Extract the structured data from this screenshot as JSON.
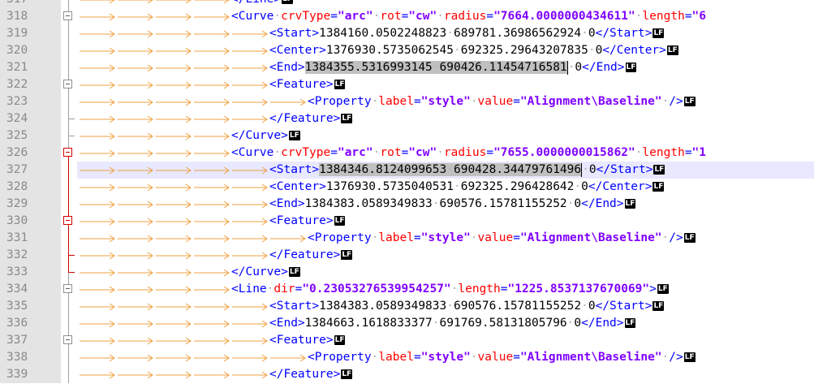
{
  "editor": {
    "current_line": 327,
    "colors": {
      "gutter_bg": "#e4e4e4",
      "current_line_bg": "#e8e8ff",
      "tag": "#0000ff",
      "attribute": "#ff0000",
      "value": "#8000ff",
      "fold_active": "#d40000",
      "indent_arrow": "#f0a040",
      "selection": "#c0c0c0"
    },
    "eol_marker": "LF",
    "lines": [
      {
        "num": "317",
        "indent": 4,
        "fold": "line",
        "tokens": [
          {
            "t": "tag",
            "v": "</Line>"
          }
        ]
      },
      {
        "num": "318",
        "indent": 4,
        "fold": "box",
        "tokens": [
          {
            "t": "tag",
            "v": "<Curve"
          },
          {
            "t": "sp"
          },
          {
            "t": "attr",
            "v": "crvType"
          },
          {
            "t": "tag",
            "v": "="
          },
          {
            "t": "val",
            "v": "\"arc\""
          },
          {
            "t": "sp"
          },
          {
            "t": "attr",
            "v": "rot"
          },
          {
            "t": "tag",
            "v": "="
          },
          {
            "t": "val",
            "v": "\"cw\""
          },
          {
            "t": "sp"
          },
          {
            "t": "attr",
            "v": "radius"
          },
          {
            "t": "tag",
            "v": "="
          },
          {
            "t": "val",
            "v": "\"7664.0000000434611\""
          },
          {
            "t": "sp"
          },
          {
            "t": "attr",
            "v": "length"
          },
          {
            "t": "tag",
            "v": "="
          },
          {
            "t": "val",
            "v": "\"6"
          }
        ],
        "noeol": true
      },
      {
        "num": "319",
        "indent": 5,
        "fold": "line",
        "tokens": [
          {
            "t": "tag",
            "v": "<Start>"
          },
          {
            "t": "txt",
            "v": "1384160.0502248823"
          },
          {
            "t": "sp"
          },
          {
            "t": "txt",
            "v": "689781.36986562924"
          },
          {
            "t": "sp"
          },
          {
            "t": "txt",
            "v": "0"
          },
          {
            "t": "tag",
            "v": "</Start>"
          }
        ]
      },
      {
        "num": "320",
        "indent": 5,
        "fold": "line",
        "tokens": [
          {
            "t": "tag",
            "v": "<Center>"
          },
          {
            "t": "txt",
            "v": "1376930.5735062545"
          },
          {
            "t": "sp"
          },
          {
            "t": "txt",
            "v": "692325.29643207835"
          },
          {
            "t": "sp"
          },
          {
            "t": "txt",
            "v": "0"
          },
          {
            "t": "tag",
            "v": "</Center>"
          }
        ]
      },
      {
        "num": "321",
        "indent": 5,
        "fold": "line",
        "tokens": [
          {
            "t": "tag",
            "v": "<End>"
          },
          {
            "t": "sel",
            "v": "1384355.5316993145"
          },
          {
            "t": "selsp"
          },
          {
            "t": "sel",
            "v": "690426.11454716581"
          },
          {
            "t": "caret"
          },
          {
            "t": "sp"
          },
          {
            "t": "txt",
            "v": "0"
          },
          {
            "t": "tag",
            "v": "</End>"
          }
        ]
      },
      {
        "num": "322",
        "indent": 5,
        "fold": "box",
        "tokens": [
          {
            "t": "tag",
            "v": "<Feature>"
          }
        ]
      },
      {
        "num": "323",
        "indent": 6,
        "fold": "line",
        "tokens": [
          {
            "t": "tag",
            "v": "<Property"
          },
          {
            "t": "sp"
          },
          {
            "t": "attr",
            "v": "label"
          },
          {
            "t": "tag",
            "v": "="
          },
          {
            "t": "val",
            "v": "\"style\""
          },
          {
            "t": "sp"
          },
          {
            "t": "attr",
            "v": "value"
          },
          {
            "t": "tag",
            "v": "="
          },
          {
            "t": "val",
            "v": "\"Alignment\\Baseline\""
          },
          {
            "t": "sp"
          },
          {
            "t": "tag",
            "v": "/>"
          }
        ]
      },
      {
        "num": "324",
        "indent": 5,
        "fold": "end",
        "tokens": [
          {
            "t": "tag",
            "v": "</Feature>"
          }
        ]
      },
      {
        "num": "325",
        "indent": 4,
        "fold": "end",
        "tokens": [
          {
            "t": "tag",
            "v": "</Curve>"
          }
        ]
      },
      {
        "num": "326",
        "indent": 4,
        "fold": "boxred",
        "tokens": [
          {
            "t": "tag",
            "v": "<Curve"
          },
          {
            "t": "sp"
          },
          {
            "t": "attr",
            "v": "crvType"
          },
          {
            "t": "tag",
            "v": "="
          },
          {
            "t": "val",
            "v": "\"arc\""
          },
          {
            "t": "sp"
          },
          {
            "t": "attr",
            "v": "rot"
          },
          {
            "t": "tag",
            "v": "="
          },
          {
            "t": "val",
            "v": "\"cw\""
          },
          {
            "t": "sp"
          },
          {
            "t": "attr",
            "v": "radius"
          },
          {
            "t": "tag",
            "v": "="
          },
          {
            "t": "val",
            "v": "\"7655.0000000015862\""
          },
          {
            "t": "sp"
          },
          {
            "t": "attr",
            "v": "length"
          },
          {
            "t": "tag",
            "v": "="
          },
          {
            "t": "val",
            "v": "\"1"
          }
        ],
        "noeol": true
      },
      {
        "num": "327",
        "indent": 5,
        "fold": "red",
        "tokens": [
          {
            "t": "tag",
            "v": "<Start>"
          },
          {
            "t": "sel",
            "v": "1384346.8124099653"
          },
          {
            "t": "selsp"
          },
          {
            "t": "sel",
            "v": "690428.34479761496"
          },
          {
            "t": "caret"
          },
          {
            "t": "sp"
          },
          {
            "t": "txt",
            "v": "0"
          },
          {
            "t": "tag",
            "v": "</Start>"
          }
        ]
      },
      {
        "num": "328",
        "indent": 5,
        "fold": "red",
        "tokens": [
          {
            "t": "tag",
            "v": "<Center>"
          },
          {
            "t": "txt",
            "v": "1376930.5735040531"
          },
          {
            "t": "sp"
          },
          {
            "t": "txt",
            "v": "692325.296428642"
          },
          {
            "t": "sp"
          },
          {
            "t": "txt",
            "v": "0"
          },
          {
            "t": "tag",
            "v": "</Center>"
          }
        ]
      },
      {
        "num": "329",
        "indent": 5,
        "fold": "red",
        "tokens": [
          {
            "t": "tag",
            "v": "<End>"
          },
          {
            "t": "txt",
            "v": "1384383.0589349833"
          },
          {
            "t": "sp"
          },
          {
            "t": "txt",
            "v": "690576.15781155252"
          },
          {
            "t": "sp"
          },
          {
            "t": "txt",
            "v": "0"
          },
          {
            "t": "tag",
            "v": "</End>"
          }
        ]
      },
      {
        "num": "330",
        "indent": 5,
        "fold": "boxredline",
        "tokens": [
          {
            "t": "tag",
            "v": "<Feature>"
          }
        ]
      },
      {
        "num": "331",
        "indent": 6,
        "fold": "red",
        "tokens": [
          {
            "t": "tag",
            "v": "<Property"
          },
          {
            "t": "sp"
          },
          {
            "t": "attr",
            "v": "label"
          },
          {
            "t": "tag",
            "v": "="
          },
          {
            "t": "val",
            "v": "\"style\""
          },
          {
            "t": "sp"
          },
          {
            "t": "attr",
            "v": "value"
          },
          {
            "t": "tag",
            "v": "="
          },
          {
            "t": "val",
            "v": "\"Alignment\\Baseline\""
          },
          {
            "t": "sp"
          },
          {
            "t": "tag",
            "v": "/>"
          }
        ]
      },
      {
        "num": "332",
        "indent": 5,
        "fold": "redend",
        "tokens": [
          {
            "t": "tag",
            "v": "</Feature>"
          }
        ]
      },
      {
        "num": "333",
        "indent": 4,
        "fold": "redfinal",
        "tokens": [
          {
            "t": "tag",
            "v": "</Curve>"
          }
        ]
      },
      {
        "num": "334",
        "indent": 4,
        "fold": "box",
        "tokens": [
          {
            "t": "tag",
            "v": "<Line"
          },
          {
            "t": "sp"
          },
          {
            "t": "attr",
            "v": "dir"
          },
          {
            "t": "tag",
            "v": "="
          },
          {
            "t": "val",
            "v": "\"0.23053276539954257\""
          },
          {
            "t": "sp"
          },
          {
            "t": "attr",
            "v": "length"
          },
          {
            "t": "tag",
            "v": "="
          },
          {
            "t": "val",
            "v": "\"1225.8537137670069\""
          },
          {
            "t": "tag",
            "v": ">"
          }
        ]
      },
      {
        "num": "335",
        "indent": 5,
        "fold": "line",
        "tokens": [
          {
            "t": "tag",
            "v": "<Start>"
          },
          {
            "t": "txt",
            "v": "1384383.0589349833"
          },
          {
            "t": "sp"
          },
          {
            "t": "txt",
            "v": "690576.15781155252"
          },
          {
            "t": "sp"
          },
          {
            "t": "txt",
            "v": "0"
          },
          {
            "t": "tag",
            "v": "</Start>"
          }
        ]
      },
      {
        "num": "336",
        "indent": 5,
        "fold": "line",
        "tokens": [
          {
            "t": "tag",
            "v": "<End>"
          },
          {
            "t": "txt",
            "v": "1384663.1618833377"
          },
          {
            "t": "sp"
          },
          {
            "t": "txt",
            "v": "691769.58131805796"
          },
          {
            "t": "sp"
          },
          {
            "t": "txt",
            "v": "0"
          },
          {
            "t": "tag",
            "v": "</End>"
          }
        ]
      },
      {
        "num": "337",
        "indent": 5,
        "fold": "box",
        "tokens": [
          {
            "t": "tag",
            "v": "<Feature>"
          }
        ]
      },
      {
        "num": "338",
        "indent": 6,
        "fold": "line",
        "tokens": [
          {
            "t": "tag",
            "v": "<Property"
          },
          {
            "t": "sp"
          },
          {
            "t": "attr",
            "v": "label"
          },
          {
            "t": "tag",
            "v": "="
          },
          {
            "t": "val",
            "v": "\"style\""
          },
          {
            "t": "sp"
          },
          {
            "t": "attr",
            "v": "value"
          },
          {
            "t": "tag",
            "v": "="
          },
          {
            "t": "val",
            "v": "\"Alignment\\Baseline\""
          },
          {
            "t": "sp"
          },
          {
            "t": "tag",
            "v": "/>"
          }
        ]
      },
      {
        "num": "339",
        "indent": 5,
        "fold": "line",
        "tokens": [
          {
            "t": "tag",
            "v": "</Feature>"
          }
        ]
      }
    ]
  }
}
